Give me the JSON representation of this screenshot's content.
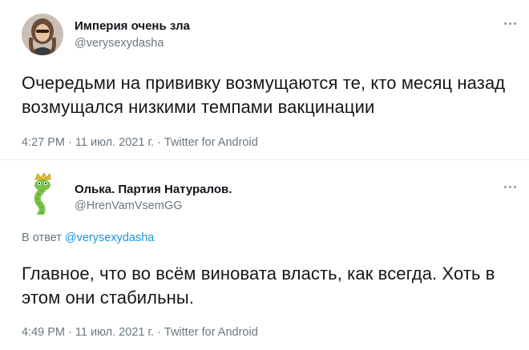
{
  "tweets": [
    {
      "author_name": "Империя очень зла",
      "handle": "@verysexydasha",
      "text": "Очередьми на прививку возмущаются те, кто месяц назад возмущался низкими темпами вакцинации",
      "time": "4:27 PM",
      "date": "11 июл. 2021 г.",
      "source": "Twitter for Android",
      "separator": "·"
    },
    {
      "author_name": "Олька. Партия Натуралов.",
      "handle": "@HrenVamVsemGG",
      "reply_prefix": "В ответ",
      "reply_to": "@verysexydasha",
      "text": "Главное, что во всём виновата власть, как всегда. Хоть в этом они стабильны.",
      "time": "4:49 PM",
      "date": "11 июл. 2021 г.",
      "source": "Twitter for Android",
      "separator": "·"
    }
  ],
  "icons": {
    "more": "more-options-icon",
    "avatar1": "avatar-photo",
    "avatar2": "avatar-snake-crown"
  }
}
